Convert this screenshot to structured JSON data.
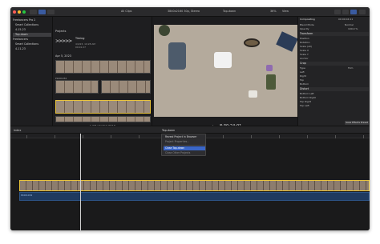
{
  "toolbar": {
    "all_clips": "All Clips",
    "resolution": "3840x2160 30p, Stereo",
    "project": "Top-down",
    "zoom": "36%",
    "view": "View",
    "inspector_title": "Compositing",
    "inspector_time": "00:00:04:11"
  },
  "sidebar": {
    "items": [
      {
        "label": "Freelancers Pro 2"
      },
      {
        "label": "Smart Collections"
      },
      {
        "label": "4-15-23"
      },
      {
        "label": "Top-down"
      },
      {
        "label": "Freelancers"
      },
      {
        "label": "Smart Collections"
      },
      {
        "label": "4-11-23"
      }
    ]
  },
  "browser": {
    "projects_label": "Projects",
    "project_name": "Timing",
    "project_date": "4/4/23, 10:28 AM",
    "project_duration": "00:01:27",
    "date_group": "Apr 5, 2023",
    "clip_label": "P1001034",
    "footer": "1 of 5 selected, 03:19"
  },
  "viewer": {
    "timecode": "8:30:24:01",
    "menu": "Top down"
  },
  "inspector": {
    "rows": [
      "Blend Mode",
      "Opacity",
      "Transform",
      "Position",
      "Rotation",
      "Scale (All)",
      "Scale X",
      "Scale Y",
      "Anchor",
      "Crop",
      "Type",
      "Left",
      "Right",
      "Top",
      "Bottom",
      "Distort",
      "Bottom Left",
      "Bottom Right",
      "Top Right",
      "Top Left"
    ],
    "blend_value": "Normal",
    "opacity_value": "100.0 %",
    "crop_type": "Trim",
    "save_button": "Save Effects Preset"
  },
  "timeline": {
    "index_label": "Index",
    "audio_label": "P1001034",
    "menu_title": "Top-down",
    "menu_items": [
      {
        "label": "Reveal Project in Browser"
      },
      {
        "label": "Project Properties..."
      },
      {
        "label": "Close Top-down"
      },
      {
        "label": "Close Other Projects"
      }
    ]
  }
}
